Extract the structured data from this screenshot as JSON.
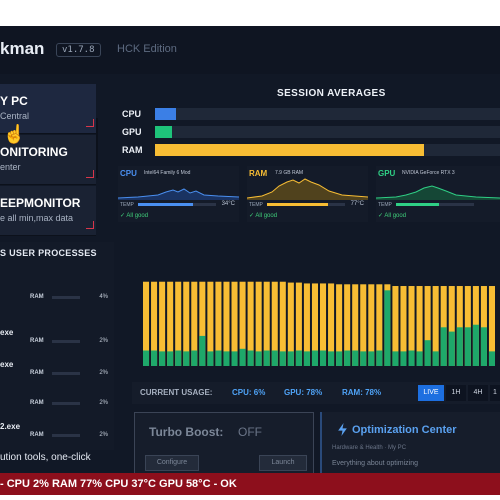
{
  "app": {
    "title": "kman",
    "version": "v1.7.8",
    "edition": "HCK Edition"
  },
  "sidebar": {
    "items": [
      {
        "title": "Y PC",
        "subtitle": "Central"
      },
      {
        "title": "ONITORING",
        "subtitle": "enter"
      },
      {
        "title": "EEPMONITOR",
        "subtitle": "e all min,max data"
      }
    ]
  },
  "processes": {
    "header": "S USER PROCESSES",
    "ram_label": "RAM",
    "rows": [
      {
        "name": "",
        "ram_pct": "4%"
      },
      {
        "name": "exe",
        "ram_pct": "2%"
      },
      {
        "name": "exe",
        "ram_pct": "2%"
      },
      {
        "name": "",
        "ram_pct": "2%"
      },
      {
        "name": "2.exe",
        "ram_pct": "2%"
      }
    ]
  },
  "tools_text": "ution tools, one-click",
  "session": {
    "title": "SESSION AVERAGES",
    "rows": [
      {
        "label": "CPU",
        "value": 6,
        "color": "#3b7fe6"
      },
      {
        "label": "GPU",
        "value": 5,
        "color": "#1ec47a"
      },
      {
        "label": "RAM",
        "value": 78,
        "color": "#f7bd34"
      }
    ]
  },
  "minis": [
    {
      "name": "CPU",
      "model": "Intel64 Family 6 Mod",
      "temp_label": "TEMP",
      "temp": "34°C",
      "status": "✓ All good",
      "color": "#4a8ff0"
    },
    {
      "name": "RAM",
      "model": "7.9 GB RAM",
      "temp_label": "TEMP",
      "temp": "77°C",
      "status": "✓ All good",
      "color": "#f7bd34"
    },
    {
      "name": "GPU",
      "model": "NVIDIA GeForce RTX 3",
      "temp_label": "TEMP",
      "temp": "",
      "status": "✓ All good",
      "color": "#2fcf85"
    }
  ],
  "chart_data": {
    "type": "bar",
    "series": [
      {
        "name": "GPU",
        "values": [
          18,
          18,
          17,
          17,
          18,
          17,
          18,
          35,
          17,
          18,
          17,
          17,
          20,
          18,
          17,
          18,
          18,
          17,
          17,
          18,
          17,
          18,
          18,
          17,
          17,
          18,
          18,
          17,
          17,
          18,
          88,
          17,
          17,
          18,
          17,
          30,
          17,
          45,
          40,
          45,
          45,
          48,
          45,
          17
        ]
      },
      {
        "name": "RAM",
        "values": [
          98,
          98,
          98,
          98,
          98,
          98,
          98,
          98,
          98,
          98,
          98,
          98,
          98,
          98,
          98,
          98,
          98,
          98,
          97,
          97,
          96,
          96,
          96,
          96,
          95,
          95,
          95,
          95,
          95,
          95,
          95,
          93,
          93,
          93,
          93,
          93,
          93,
          93,
          93,
          93,
          93,
          93,
          93,
          93
        ]
      }
    ],
    "colors": {
      "ram": "#f7bd34",
      "gpu": "#1ea86a"
    },
    "ylim": [
      0,
      100
    ]
  },
  "usage": {
    "label": "CURRENT USAGE:",
    "cpu": "CPU: 6%",
    "gpu": "GPU: 78%",
    "ram": "RAM: 78%",
    "ranges": [
      "LIVE",
      "1H",
      "4H",
      "1"
    ]
  },
  "turbo": {
    "title": "Turbo Boost:",
    "value": "OFF",
    "configure": "Configure",
    "launch": "Launch"
  },
  "optimization": {
    "title": "Optimization Center",
    "subtitle": "Hardware & Health · My PC",
    "subtitle2": "Everything about optimizing"
  },
  "status": "- CPU 2% RAM 77% CPU 37°C GPU 58°C - OK"
}
